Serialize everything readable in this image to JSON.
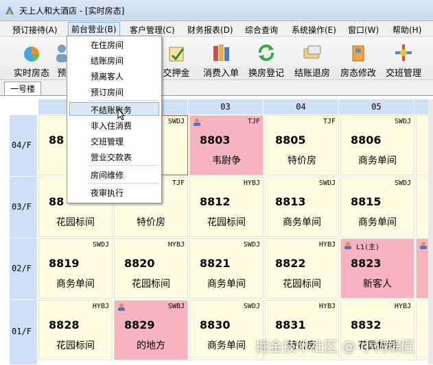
{
  "window": {
    "title": "天上人和大酒店 - [实时房态]"
  },
  "menubar": [
    {
      "label": "预订接待(A)"
    },
    {
      "label": "前台营业(B)"
    },
    {
      "label": "客户管理(C)"
    },
    {
      "label": "财务报表(D)"
    },
    {
      "label": "综合查询"
    },
    {
      "label": "系统操作(E)"
    },
    {
      "label": "窗口(W)"
    },
    {
      "label": "帮助(H)"
    }
  ],
  "toolbar": [
    {
      "label": "实时房态",
      "icon": "chart-icon"
    },
    {
      "label": "预",
      "icon": "person-icon"
    },
    {
      "label": "交押金",
      "icon": "deposit-icon"
    },
    {
      "label": "消费入单",
      "icon": "books-icon"
    },
    {
      "label": "换房登记",
      "icon": "refresh-icon"
    },
    {
      "label": "结账退房",
      "icon": "checkout-icon"
    },
    {
      "label": "房态修改",
      "icon": "edit-icon"
    },
    {
      "label": "交班管理",
      "icon": "handover-icon"
    }
  ],
  "tab": {
    "label": "一号楼"
  },
  "columns": [
    "03",
    "04",
    "05"
  ],
  "rows": [
    "04/F",
    "03/F",
    "02/F",
    "01/F"
  ],
  "dropdown": {
    "items": [
      "在住房间",
      "结账房间",
      "预离客人",
      "预订房间",
      "不结账账务",
      "非入住消费",
      "交班管理",
      "营业交款表",
      "房间维修",
      "夜审执行"
    ],
    "highlighted_index": 4
  },
  "cells": {
    "r0": [
      {
        "num": "88",
        "type": "",
        "name": "特"
      },
      {
        "num": "",
        "type": "SWDJ",
        "name": "间"
      },
      {
        "num": "8803",
        "type": "TJF",
        "name": "韦尉争",
        "occupied": true
      },
      {
        "num": "8805",
        "type": "TJF",
        "name": "特价房"
      },
      {
        "num": "8806",
        "type": "SWDJ",
        "name": "商务单间"
      }
    ],
    "r1": [
      {
        "num": "88",
        "type": "",
        "name": "花园标间"
      },
      {
        "num": "",
        "type": "TJF",
        "name": "特价房"
      },
      {
        "num": "8812",
        "type": "HYBJ",
        "name": "花园标间"
      },
      {
        "num": "8813",
        "type": "SWDJ",
        "name": "商务单间"
      },
      {
        "num": "8815",
        "type": "SWDJ",
        "name": "商务单间"
      }
    ],
    "r2": [
      {
        "num": "8819",
        "type": "SWDJ",
        "name": "商务单间"
      },
      {
        "num": "8820",
        "type": "HYBJ",
        "name": "花园标间"
      },
      {
        "num": "8821",
        "type": "SWDJ",
        "name": "商务单间"
      },
      {
        "num": "8822",
        "type": "HYBJ",
        "name": "花园标间"
      },
      {
        "num": "8823",
        "type": "",
        "name": "新客人",
        "occupied": true,
        "note": "L1(主)"
      }
    ],
    "r3": [
      {
        "num": "8828",
        "type": "HYBJ",
        "name": "花园标间"
      },
      {
        "num": "8829",
        "type": "SWBJ",
        "name": "的地方",
        "occupied": true
      },
      {
        "num": "8830",
        "type": "SWDJ",
        "name": "商务单间"
      },
      {
        "num": "8831",
        "type": "HYBJ",
        "name": "特价房"
      },
      {
        "num": "8832",
        "type": "HYBJ",
        "name": "花园标间"
      }
    ]
  },
  "watermark": "掘金技术社区 @ 小码编匠"
}
